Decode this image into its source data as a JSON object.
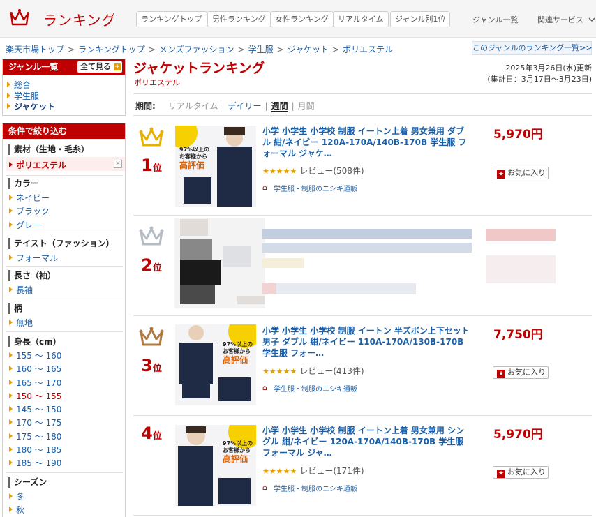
{
  "header": {
    "logo_text": "ランキング",
    "nav": [
      "ランキングトップ",
      "男性ランキング",
      "女性ランキング",
      "リアルタイム",
      "ジャンル別1位"
    ],
    "genre_list": "ジャンル一覧",
    "related": "関連サービス"
  },
  "breadcrumb": [
    "楽天市場トップ",
    "ランキングトップ",
    "メンズファッション",
    "学生服",
    "ジャケット",
    "ポリエステル"
  ],
  "breadcrumb_sep": ">",
  "genre_ranking_link": "このジャンルのランキング一覧>>",
  "sidebar": {
    "genre_title": "ジャンル一覧",
    "show_all": "全て見る",
    "genres": [
      "総合",
      "学生服",
      "ジャケット"
    ],
    "filter_title": "条件で絞り込む",
    "sections": {
      "material": {
        "title": "素材（生地・毛糸）",
        "selected": "ポリエステル"
      },
      "color": {
        "title": "カラー",
        "items": [
          "ネイビー",
          "ブラック",
          "グレー"
        ]
      },
      "taste": {
        "title": "テイスト（ファッション）",
        "items": [
          "フォーマル"
        ]
      },
      "sleeve": {
        "title": "長さ（袖）",
        "items": [
          "長袖"
        ]
      },
      "pattern": {
        "title": "柄",
        "items": [
          "無地"
        ]
      },
      "height": {
        "title": "身長（cm）",
        "items": [
          "155 〜 160",
          "160 〜 165",
          "165 〜 170",
          "150 〜 155",
          "145 〜 150",
          "170 〜 175",
          "175 〜 180",
          "180 〜 185",
          "185 〜 190"
        ]
      },
      "season": {
        "title": "シーズン",
        "items": [
          "冬",
          "秋"
        ]
      }
    }
  },
  "main": {
    "title": "ジャケットランキング",
    "subtitle": "ポリエステル",
    "updated": "2025年3月26日(水)更新",
    "period_range": "(集計日：3月17日〜3月23日)",
    "period_label": "期間:",
    "periods": [
      "リアルタイム",
      "デイリー",
      "週間",
      "月間"
    ],
    "rank_suffix": "位",
    "fav_label": "お気に入り",
    "items": [
      {
        "rank": "1",
        "name": "小学 小学生 小学校 制服 イートン上着 男女兼用 ダブル 紺/ネイビー 120A-170A/140B-170B 学生服 フォーマル ジャケ…",
        "stars": "★★★★★",
        "reviews": "レビュー(508件)",
        "shop": "学生服・制服のニシキ通販",
        "price": "5,970円",
        "image_text": [
          "97%以上の",
          "お客様から",
          "高評価"
        ]
      },
      {
        "rank": "2"
      },
      {
        "rank": "3",
        "name": "小学 小学生 小学校 制服 イートン 半ズボン上下セット 男子 ダブル 紺/ネイビー 110A-170A/130B-170B 学生服 フォー…",
        "stars": "★★★★★",
        "reviews": "レビュー(413件)",
        "shop": "学生服・制服のニシキ通販",
        "price": "7,750円",
        "image_text": [
          "97%以上の",
          "お客様から",
          "高評価"
        ]
      },
      {
        "rank": "4",
        "name": "小学 小学生 小学校 制服 イートン上着 男女兼用 シングル 紺/ネイビー 120A-170A/140B-170B 学生服 フォーマル ジャ…",
        "stars": "★★★★★",
        "reviews": "レビュー(171件)",
        "shop": "学生服・制服のニシキ通販",
        "price": "5,970円",
        "image_text": [
          "97%以上の",
          "お客様から",
          "高評価"
        ]
      }
    ]
  },
  "colors": {
    "accent": "#bf0000",
    "link": "#1a5fa8",
    "gold": "#e8a000",
    "silver": "#b5bcc4",
    "bronze": "#b07a40"
  }
}
